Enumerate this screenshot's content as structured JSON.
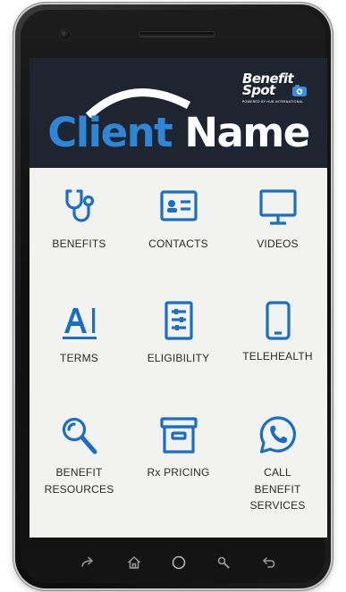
{
  "header": {
    "client_word1": "Client",
    "client_word2": "Name",
    "logo": {
      "line1": "Benefit",
      "line2": "Spot",
      "tagline": "POWERED BY HUB INTERNATIONAL"
    }
  },
  "grid": [
    {
      "label": "BENEFITS",
      "icon": "stethoscope-icon"
    },
    {
      "label": "CONTACTS",
      "icon": "contact-card-icon"
    },
    {
      "label": "VIDEOS",
      "icon": "monitor-icon"
    },
    {
      "label": "TERMS",
      "icon": "text-format-icon"
    },
    {
      "label": "ELIGIBILITY",
      "icon": "checklist-icon"
    },
    {
      "label": "TELEHEALTH",
      "icon": "smartphone-icon"
    },
    {
      "label": "BENEFIT\nRESOURCES",
      "icon": "magnifier-icon"
    },
    {
      "label": "Rx PRICING",
      "icon": "archive-box-icon"
    },
    {
      "label": "CALL\nBENEFIT\nSERVICES",
      "icon": "whatsapp-phone-icon"
    }
  ],
  "navbar": [
    "share-icon",
    "home-icon",
    "circle-home-icon",
    "search-icon",
    "back-icon"
  ],
  "colors": {
    "accent": "#1a6fc4",
    "banner": "#1e2530",
    "screen_bg": "#f2f2f0"
  }
}
